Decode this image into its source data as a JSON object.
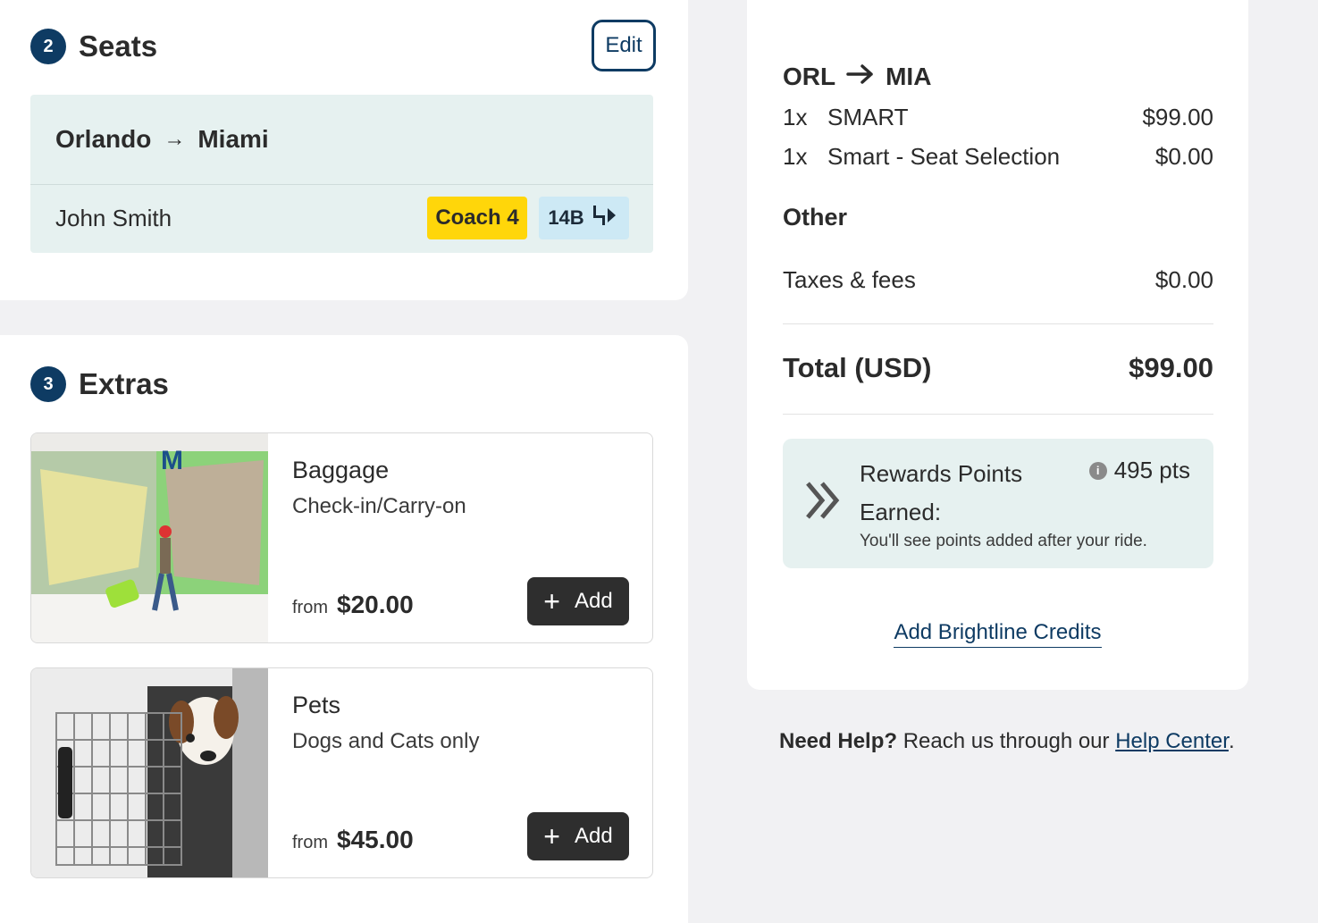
{
  "seats": {
    "step_number": "2",
    "title": "Seats",
    "edit_label": "Edit",
    "origin": "Orlando",
    "destination": "Miami",
    "passenger_name": "John Smith",
    "coach": "Coach 4",
    "seat": "14B"
  },
  "extras": {
    "step_number": "3",
    "title": "Extras",
    "items": [
      {
        "title": "Baggage",
        "subtitle": "Check-in/Carry-on",
        "from_label": "from",
        "price": "$20.00",
        "add_label": "Add",
        "image": "baggage-photo"
      },
      {
        "title": "Pets",
        "subtitle": "Dogs and Cats only",
        "from_label": "from",
        "price": "$45.00",
        "add_label": "Add",
        "image": "pet-carrier-photo"
      }
    ]
  },
  "summary": {
    "origin_code": "ORL",
    "destination_code": "MIA",
    "lines": [
      {
        "qty": "1x",
        "name": "SMART",
        "price": "$99.00"
      },
      {
        "qty": "1x",
        "name": "Smart - Seat Selection",
        "price": "$0.00"
      }
    ],
    "other_label": "Other",
    "taxes_label": "Taxes & fees",
    "taxes_value": "$0.00",
    "total_label": "Total (USD)",
    "total_value": "$99.00",
    "rewards": {
      "title": "Rewards Points Earned:",
      "points": "495 pts",
      "note": "You'll see points added after your ride."
    },
    "credits_link": "Add Brightline Credits"
  },
  "help": {
    "bold": "Need Help?",
    "text": "Reach us through our",
    "link": "Help Center",
    "end": "."
  },
  "colors": {
    "brand_navy": "#0e3b63",
    "coach_yellow": "#ffd60a",
    "seat_blue": "#cde9f5",
    "panel_teal": "#e6f1f0"
  }
}
